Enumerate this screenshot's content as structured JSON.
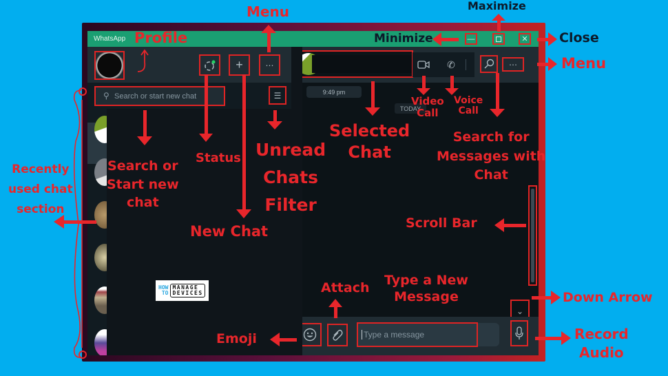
{
  "window": {
    "app_title": "WhatsApp",
    "minimize_icon": "minimize-icon",
    "maximize_icon": "maximize-icon",
    "close_icon": "close-icon"
  },
  "sidebar": {
    "status_icon": "status-ring-icon",
    "new_chat_icon": "plus-icon",
    "menu_icon": "ellipsis-icon",
    "search": {
      "placeholder": "Search or start new chat",
      "value": ""
    },
    "filter_icon": "filter-icon",
    "chats_count_visible": 7
  },
  "chat": {
    "timestamp": "9:49 pm",
    "date_divider": "TODAY",
    "header_icons": [
      "video-call-icon",
      "voice-call-icon",
      "search-icon",
      "ellipsis-icon"
    ],
    "composer": {
      "placeholder": "Type a message",
      "value": "",
      "icons": [
        "emoji-icon",
        "attach-icon",
        "microphone-icon"
      ]
    }
  },
  "watermark": {
    "line1_left": "HOW",
    "line2_left": "TO",
    "line1_right": "MANAGE",
    "line2_right": "DEVICES"
  },
  "annotations": {
    "profile": "Profile",
    "menu_top": "Menu",
    "maximize": "Maximize",
    "minimize": "Minimize",
    "close": "Close",
    "menu_right": "Menu",
    "video_call": [
      "Video",
      "Call"
    ],
    "voice_call": [
      "Voice",
      "Call"
    ],
    "selected_chat": [
      "Selected",
      "Chat"
    ],
    "search_messages": [
      "Search for",
      "Messages with",
      "Chat"
    ],
    "status": "Status",
    "search_or_start": [
      "Search or",
      "Start new",
      "chat"
    ],
    "unread_filter": [
      "Unread",
      "Chats",
      "Filter"
    ],
    "recently_used": [
      "Recently",
      "used chat",
      "section"
    ],
    "new_chat": "New Chat",
    "scroll_bar": "Scroll Bar",
    "type_message": [
      "Type a New",
      "Message"
    ],
    "attach": "Attach",
    "down_arrow": "Down Arrow",
    "emoji": "Emoji",
    "record_audio": [
      "Record",
      "Audio"
    ]
  }
}
